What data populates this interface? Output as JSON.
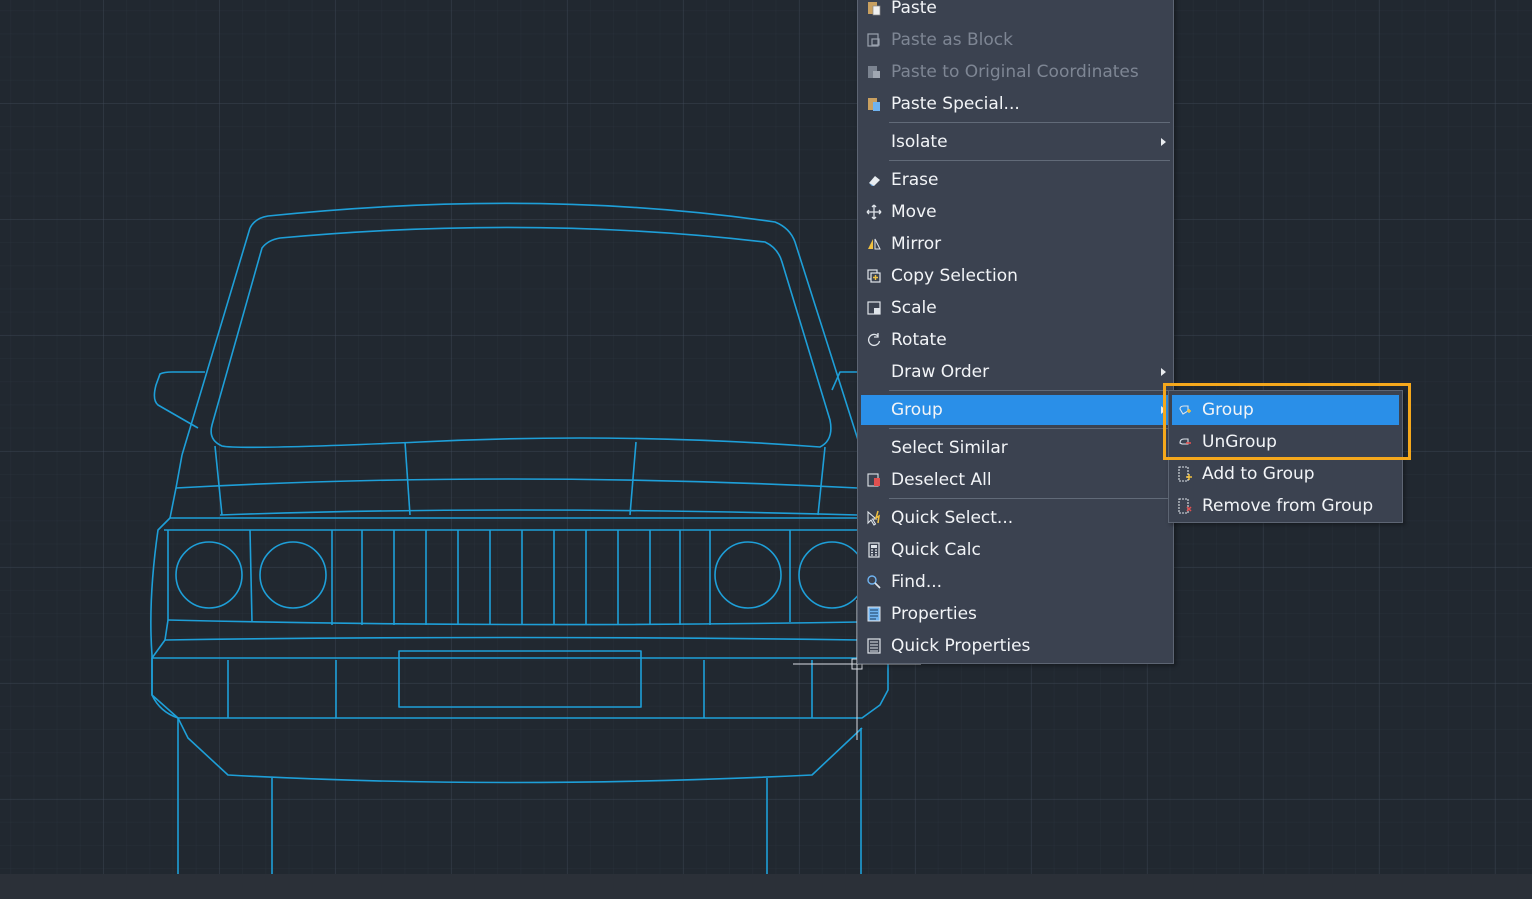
{
  "context_menu": {
    "items": [
      {
        "label": "Paste",
        "icon": "paste-icon",
        "disabled": false
      },
      {
        "label": "Paste as Block",
        "icon": "paste-as-block-icon",
        "disabled": true
      },
      {
        "label": "Paste to Original Coordinates",
        "icon": "paste-to-original-icon",
        "disabled": true
      },
      {
        "label": "Paste Special...",
        "icon": "paste-special-icon",
        "disabled": false
      },
      {
        "label": "Isolate",
        "icon": "",
        "disabled": false,
        "submenu": true
      },
      {
        "label": "Erase",
        "icon": "eraser-icon",
        "disabled": false
      },
      {
        "label": "Move",
        "icon": "move-icon",
        "disabled": false
      },
      {
        "label": "Mirror",
        "icon": "mirror-icon",
        "disabled": false
      },
      {
        "label": "Copy Selection",
        "icon": "copy-icon",
        "disabled": false
      },
      {
        "label": "Scale",
        "icon": "scale-icon",
        "disabled": false
      },
      {
        "label": "Rotate",
        "icon": "rotate-icon",
        "disabled": false
      },
      {
        "label": "Draw Order",
        "icon": "",
        "disabled": false,
        "submenu": true
      },
      {
        "label": "Group",
        "icon": "",
        "disabled": false,
        "submenu": true,
        "active": true
      },
      {
        "label": "Select Similar",
        "icon": "",
        "disabled": false
      },
      {
        "label": "Deselect All",
        "icon": "deselect-all-icon",
        "disabled": false
      },
      {
        "label": "Quick Select...",
        "icon": "quick-select-icon",
        "disabled": false
      },
      {
        "label": "Quick Calc",
        "icon": "calculator-icon",
        "disabled": false
      },
      {
        "label": "Find...",
        "icon": "find-icon",
        "disabled": false
      },
      {
        "label": "Properties",
        "icon": "properties-icon",
        "disabled": false
      },
      {
        "label": "Quick Properties",
        "icon": "quick-properties-icon",
        "disabled": false
      }
    ]
  },
  "group_submenu": {
    "items": [
      {
        "label": "Group",
        "icon": "group-icon",
        "active": true
      },
      {
        "label": "UnGroup",
        "icon": "ungroup-icon",
        "active": false
      },
      {
        "label": "Add to Group",
        "icon": "add-to-group-icon",
        "active": false
      },
      {
        "label": "Remove from Group",
        "icon": "remove-from-group-icon",
        "active": false
      }
    ]
  },
  "colors": {
    "canvas_background": "#212830",
    "drawing_lines": "#1e9fd8",
    "menu_background": "#3b4250",
    "menu_highlight": "#2a8fe8",
    "callout_box": "#f5a81c"
  }
}
